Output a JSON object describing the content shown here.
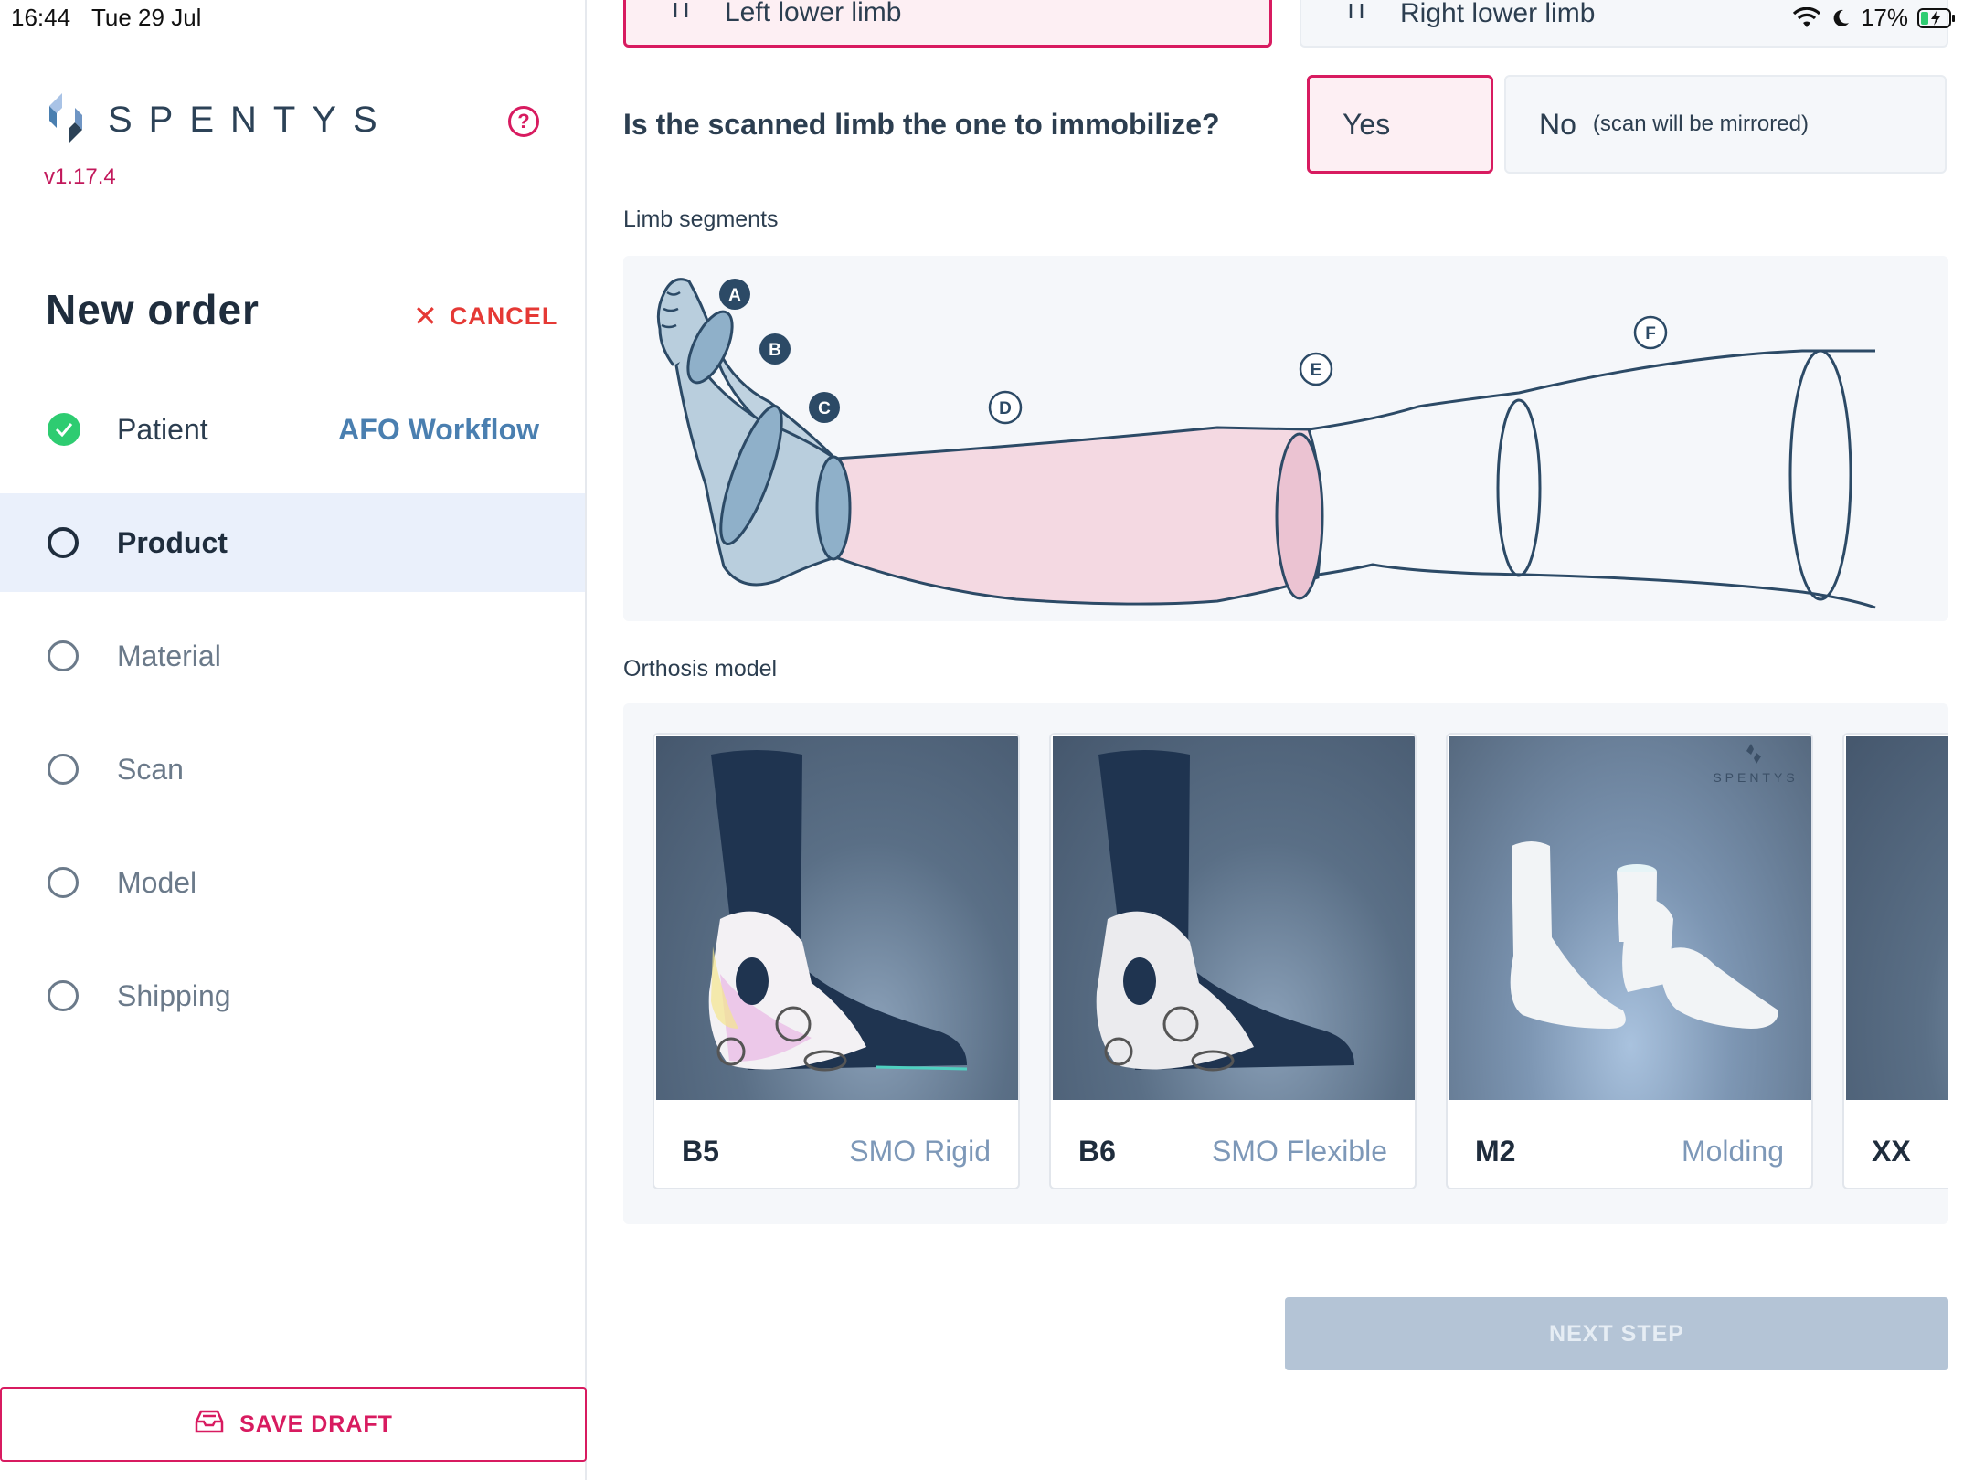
{
  "status_bar": {
    "time": "16:44",
    "date": "Tue 29 Jul",
    "battery": "17%"
  },
  "sidebar": {
    "brand": "SPENTYS",
    "version": "v1.17.4",
    "title": "New order",
    "cancel_label": "CANCEL",
    "steps": [
      {
        "label": "Patient",
        "extra": "AFO Workflow",
        "state": "done"
      },
      {
        "label": "Product",
        "state": "active"
      },
      {
        "label": "Material",
        "state": "pending"
      },
      {
        "label": "Scan",
        "state": "pending"
      },
      {
        "label": "Model",
        "state": "pending"
      },
      {
        "label": "Shipping",
        "state": "pending"
      }
    ],
    "save_draft_label": "SAVE DRAFT"
  },
  "main": {
    "limb_options": [
      {
        "label": "Left lower limb",
        "selected": true
      },
      {
        "label": "Right lower limb",
        "selected": false
      }
    ],
    "question": "Is the scanned limb the one to immobilize?",
    "yes_label": "Yes",
    "no_label": "No",
    "no_hint": "(scan will be mirrored)",
    "segments_label": "Limb segments",
    "segment_markers": [
      "A",
      "B",
      "C",
      "D",
      "E",
      "F"
    ],
    "orthosis_label": "Orthosis model",
    "models": [
      {
        "code": "B5",
        "name": "SMO Rigid"
      },
      {
        "code": "B6",
        "name": "SMO Flexible"
      },
      {
        "code": "M2",
        "name": "Molding",
        "watermark": "SPENTYS"
      },
      {
        "code": "XX",
        "name": ""
      }
    ],
    "next_label": "NEXT STEP"
  },
  "colors": {
    "accent": "#d81b60",
    "cancel": "#e53935",
    "link": "#4a7fb0",
    "done": "#2ecc71",
    "disabled_button": "#b4c4d6"
  }
}
